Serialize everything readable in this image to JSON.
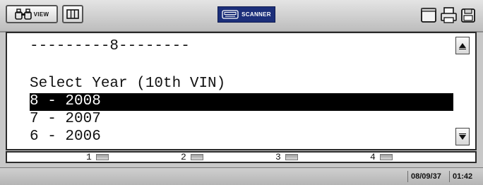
{
  "toolbar": {
    "view_label": "VIEW",
    "scanner_label": "SCANNER"
  },
  "screen": {
    "header_line": "---------8--------",
    "prompt": "Select Year (10th VIN)",
    "items": [
      {
        "label": "8 - 2008",
        "selected": true
      },
      {
        "label": "7 - 2007",
        "selected": false
      },
      {
        "label": "6 - 2006",
        "selected": false
      }
    ]
  },
  "function_keys": [
    {
      "label": "1"
    },
    {
      "label": "2"
    },
    {
      "label": "3"
    },
    {
      "label": "4"
    }
  ],
  "status": {
    "date": "08/09/37",
    "time": "01:42"
  },
  "icons": [
    "binoculars-icon",
    "split-view-icon",
    "scanner-icon",
    "window-icon",
    "print-icon",
    "save-icon",
    "scroll-up-icon",
    "scroll-down-icon"
  ]
}
